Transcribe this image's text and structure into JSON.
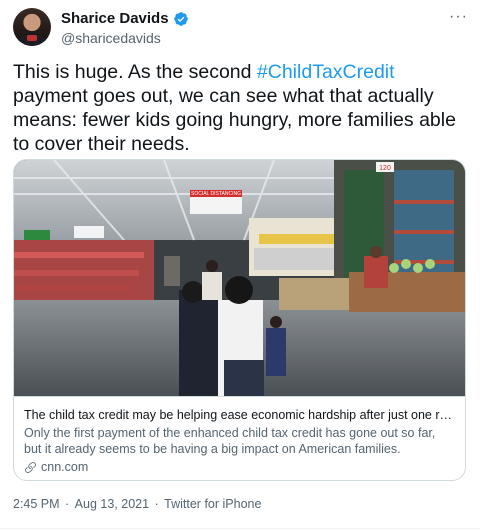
{
  "author": {
    "display_name": "Sharice Davids",
    "handle": "@sharicedavids",
    "verified": true
  },
  "tweet": {
    "text_before": "This is huge. As the second ",
    "hashtag": "#ChildTaxCredit",
    "text_after": " payment goes out, we can see what that actually means: fewer kids going hungry, more families able to cover their needs."
  },
  "card": {
    "title": "The child tax credit may be helping ease economic hardship after just one roun...",
    "description": "Only the first payment of the enhanced child tax credit has gone out so far, but it already seems to be having a big impact on American families.",
    "domain": "cnn.com",
    "image_sign": "SOCIAL DISTANCING",
    "aisle_number": "120"
  },
  "meta": {
    "time": "2:45 PM",
    "date": "Aug 13, 2021",
    "source": "Twitter for iPhone"
  },
  "colors": {
    "accent": "#1d9bf0",
    "text": "#0f1419",
    "secondary": "#536471"
  }
}
